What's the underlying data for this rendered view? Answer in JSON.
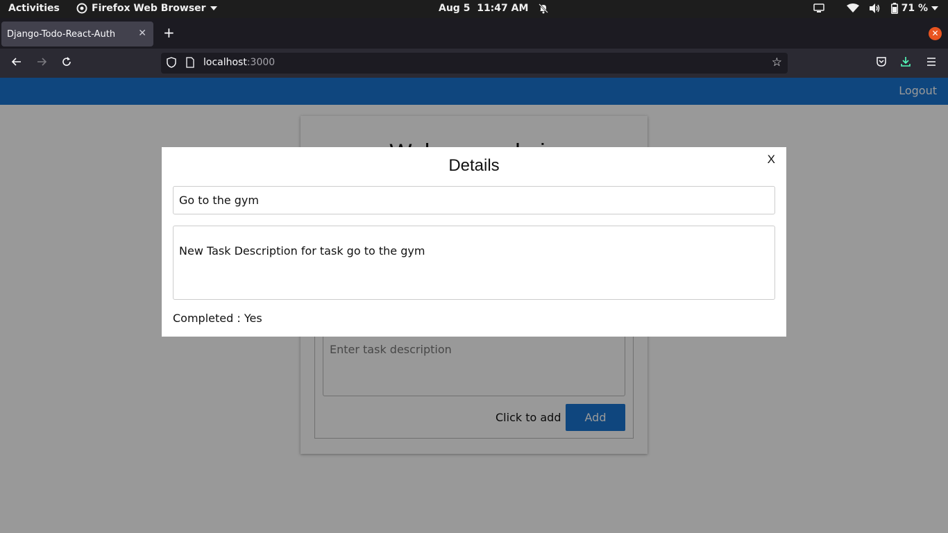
{
  "system_bar": {
    "activities": "Activities",
    "app_name": "Firefox Web Browser",
    "date": "Aug 5",
    "time": "11:47 AM",
    "battery": "71 %",
    "icons": [
      "firefox-icon",
      "chevron-down-icon",
      "bell-off-icon",
      "screen-share-icon",
      "wifi-icon",
      "volume-icon",
      "battery-icon",
      "chevron-down-icon"
    ]
  },
  "browser": {
    "tab_title": "Django-Todo-React-Auth",
    "url_host": "localhost",
    "url_port": ":3000",
    "colors": {
      "chrome": "#2b2a33",
      "tabstrip": "#1c1b22",
      "close_accent": "#e95420"
    }
  },
  "app": {
    "logout": "Logout",
    "welcome": "Welcome admin",
    "description_placeholder": "Enter task description",
    "add_label": "Click to add",
    "add_button": "Add",
    "accent": "#1976d2"
  },
  "modal": {
    "title": "Details",
    "close": "X",
    "task_title": "Go to the gym",
    "task_description": "New Task Description for task go to the gym",
    "completed": "Completed : Yes"
  }
}
